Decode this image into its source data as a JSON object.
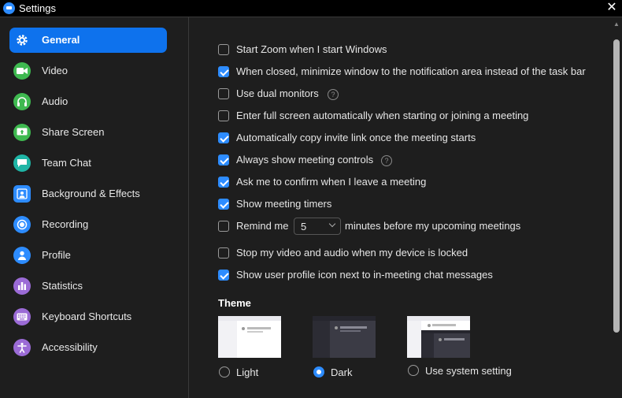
{
  "window": {
    "title": "Settings",
    "close": "✕"
  },
  "sidebar": {
    "items": [
      {
        "label": "General",
        "icon": "gear-icon",
        "color": "#0e72ed"
      },
      {
        "label": "Video",
        "icon": "video-camera-icon",
        "color": "#3fb950"
      },
      {
        "label": "Audio",
        "icon": "headphones-icon",
        "color": "#3fb950"
      },
      {
        "label": "Share Screen",
        "icon": "share-screen-icon",
        "color": "#3fb950"
      },
      {
        "label": "Team Chat",
        "icon": "chat-bubble-icon",
        "color": "#1fb5a6"
      },
      {
        "label": "Background & Effects",
        "icon": "person-background-icon",
        "color": "#2d8cff"
      },
      {
        "label": "Recording",
        "icon": "record-icon",
        "color": "#2d8cff"
      },
      {
        "label": "Profile",
        "icon": "person-icon",
        "color": "#2d8cff"
      },
      {
        "label": "Statistics",
        "icon": "bar-chart-icon",
        "color": "#9b6bd6"
      },
      {
        "label": "Keyboard Shortcuts",
        "icon": "keyboard-icon",
        "color": "#9b6bd6"
      },
      {
        "label": "Accessibility",
        "icon": "accessibility-icon",
        "color": "#9b6bd6"
      }
    ]
  },
  "options": [
    {
      "label": "Start Zoom when I start Windows",
      "checked": false
    },
    {
      "label": "When closed, minimize window to the notification area instead of the task bar",
      "checked": true
    },
    {
      "label": "Use dual monitors",
      "checked": false,
      "help": true
    },
    {
      "label": "Enter full screen automatically when starting or joining a meeting",
      "checked": false
    },
    {
      "label": "Automatically copy invite link once the meeting starts",
      "checked": true
    },
    {
      "label": "Always show meeting controls",
      "checked": true,
      "help": true
    },
    {
      "label": "Ask me to confirm when I leave a meeting",
      "checked": true
    },
    {
      "label": "Show meeting timers",
      "checked": true
    },
    {
      "label": "Remind me",
      "checked": false
    },
    {
      "label": "Stop my video and audio when my device is locked",
      "checked": false
    },
    {
      "label": "Show user profile icon next to in-meeting chat messages",
      "checked": true
    }
  ],
  "reminder": {
    "minutes": "5",
    "suffix": "minutes before my upcoming meetings"
  },
  "theme": {
    "title": "Theme",
    "choices": [
      {
        "label": "Light",
        "selected": false
      },
      {
        "label": "Dark",
        "selected": true
      },
      {
        "label": "Use system setting",
        "selected": false
      }
    ]
  },
  "help_glyph": "?",
  "accent": "#2d8cff"
}
